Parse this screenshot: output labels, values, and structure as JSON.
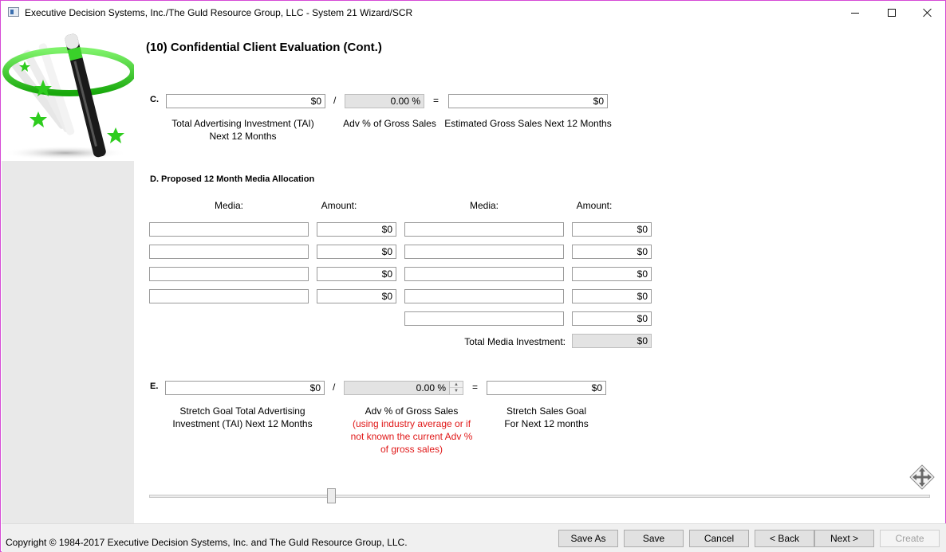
{
  "window": {
    "title": "Executive Decision Systems, Inc./The Guld Resource Group, LLC - System 21 Wizard/SCR",
    "controls": [
      "minimize",
      "maximize",
      "close"
    ]
  },
  "page": {
    "heading": "(10) Confidential Client Evaluation (Cont.)"
  },
  "section_c": {
    "label": "C.",
    "tai_value": "$0",
    "divide_op": "/",
    "adv_pct_value": "0.00 %",
    "equals_op": "=",
    "gross_sales_value": "$0",
    "tai_caption_line1": "Total Advertising Investment (TAI)",
    "tai_caption_line2": "Next 12 Months",
    "adv_pct_caption": "Adv % of Gross Sales",
    "gross_sales_caption": "Estimated Gross Sales Next 12 Months"
  },
  "section_d": {
    "label": "D. Proposed 12 Month Media Allocation",
    "media_header": "Media:",
    "amount_header": "Amount:",
    "left_rows": [
      {
        "media": "",
        "amount": "$0"
      },
      {
        "media": "",
        "amount": "$0"
      },
      {
        "media": "",
        "amount": "$0"
      },
      {
        "media": "",
        "amount": "$0"
      }
    ],
    "right_rows": [
      {
        "media": "",
        "amount": "$0"
      },
      {
        "media": "",
        "amount": "$0"
      },
      {
        "media": "",
        "amount": "$0"
      },
      {
        "media": "",
        "amount": "$0"
      },
      {
        "media": "",
        "amount": "$0"
      }
    ],
    "total_label": "Total Media Investment:",
    "total_value": "$0"
  },
  "section_e": {
    "label": "E.",
    "stretch_tai_value": "$0",
    "divide_op": "/",
    "adv_pct_value": "0.00 %",
    "equals_op": "=",
    "stretch_sales_value": "$0",
    "stretch_tai_caption_line1": "Stretch Goal Total Advertising",
    "stretch_tai_caption_line2": "Investment (TAI) Next 12 Months",
    "adv_pct_caption": "Adv % of Gross Sales",
    "adv_pct_note_line1": "(using industry average or if",
    "adv_pct_note_line2": "not known the current Adv %",
    "adv_pct_note_line3": "of gross sales)",
    "stretch_sales_caption_line1": "Stretch Sales Goal",
    "stretch_sales_caption_line2": "For Next 12 months"
  },
  "slider": {
    "position_fraction": 0.23
  },
  "footer": {
    "copyright": "Copyright © 1984-2017 Executive Decision Systems, Inc. and The Guld Resource Group, LLC.",
    "buttons": {
      "save_as": "Save As",
      "save": "Save",
      "cancel": "Cancel",
      "back": "< Back",
      "next": "Next >",
      "create": "Create"
    }
  },
  "colors": {
    "window_border": "#d64ad6",
    "note_red": "#e01818",
    "logo_green": "#2ecc1e"
  },
  "icons": [
    "app-icon",
    "magic-wand-logo",
    "move-arrows-icon",
    "spinner-up-icon",
    "spinner-down-icon"
  ]
}
